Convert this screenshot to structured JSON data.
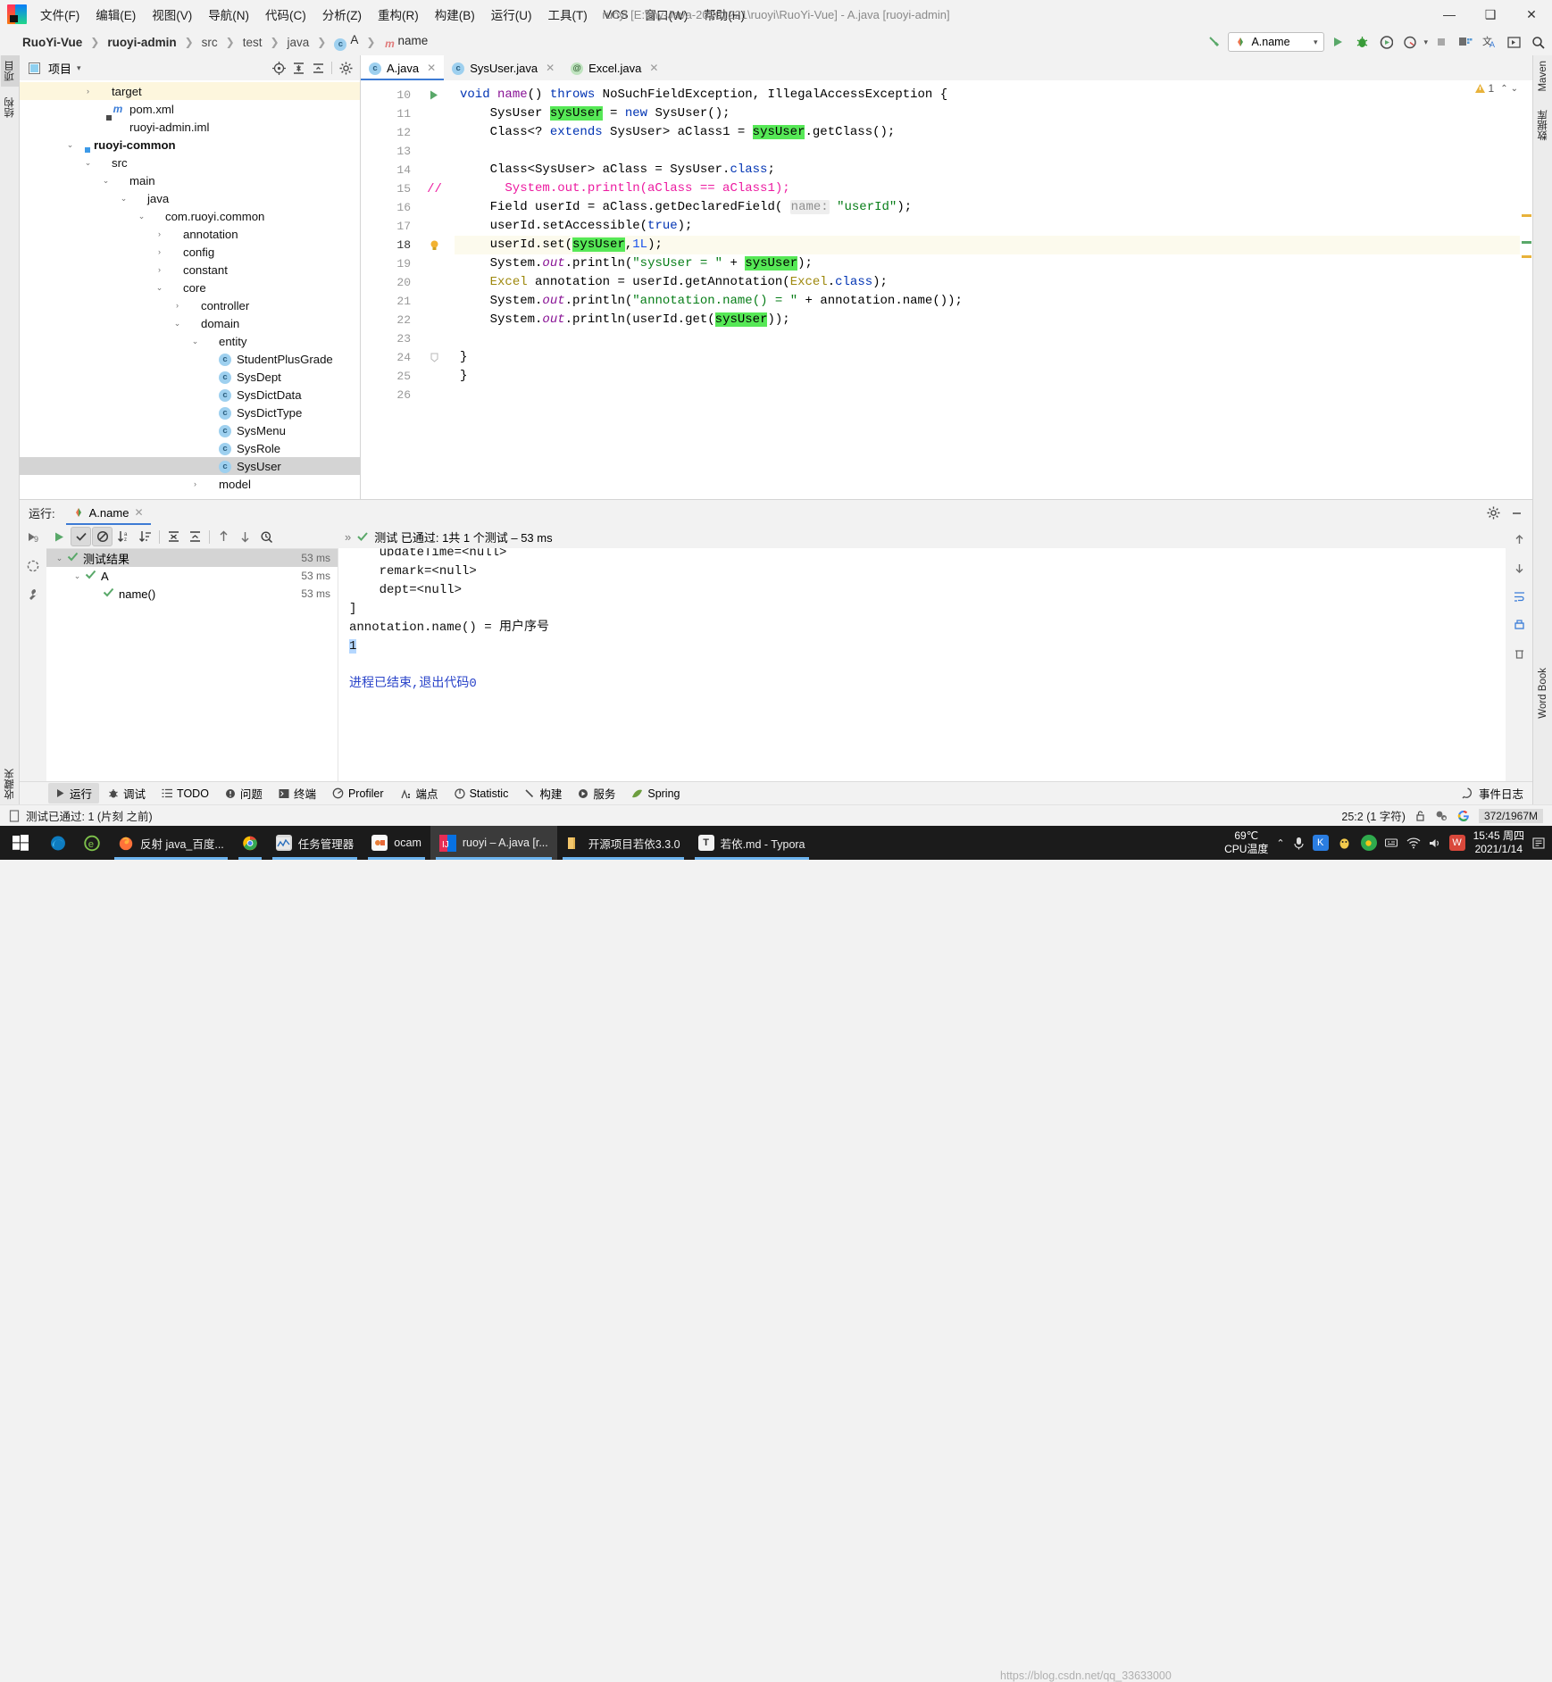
{
  "window": {
    "title": "ruoyi [E:\\my-Java-20201221\\ruoyi\\RuoYi-Vue] - A.java [ruoyi-admin]",
    "minimize": "—",
    "maximize": "❑",
    "close": "✕"
  },
  "menu": [
    {
      "label": "文件(F)"
    },
    {
      "label": "编辑(E)"
    },
    {
      "label": "视图(V)"
    },
    {
      "label": "导航(N)"
    },
    {
      "label": "代码(C)"
    },
    {
      "label": "分析(Z)"
    },
    {
      "label": "重构(R)"
    },
    {
      "label": "构建(B)"
    },
    {
      "label": "运行(U)"
    },
    {
      "label": "工具(T)"
    },
    {
      "label": "VCS"
    },
    {
      "label": "窗口(W)"
    },
    {
      "label": "帮助(H)"
    }
  ],
  "breadcrumb": [
    {
      "label": "RuoYi-Vue",
      "bold": true
    },
    {
      "label": "ruoyi-admin",
      "bold": true
    },
    {
      "label": "src"
    },
    {
      "label": "test"
    },
    {
      "label": "java"
    },
    {
      "label": "A",
      "icon": "class-icon"
    },
    {
      "label": "name",
      "icon": "method-icon"
    }
  ],
  "toolbar": {
    "run_config": "A.name",
    "run_config_dropdown": "▾",
    "buttons": [
      "build-hammer-icon",
      "run-icon",
      "debug-icon",
      "run-coverage-icon",
      "profile-icon",
      "stop-icon",
      "project-structure-icon",
      "translate-icon",
      "console-icon",
      "search-everywhere-icon"
    ]
  },
  "left_stripe": [
    {
      "label": "项目",
      "selected": true
    },
    {
      "label": "结构"
    },
    {
      "label": "收藏夹"
    }
  ],
  "right_stripe": [
    {
      "label": "Maven"
    },
    {
      "label": "数据库"
    },
    {
      "label": "Word Book"
    }
  ],
  "project_panel": {
    "title": "项目",
    "dropdown": "▾",
    "actions": [
      "locate-icon",
      "expand-all-icon",
      "collapse-all-icon",
      "settings-gear-icon"
    ],
    "tree": [
      {
        "label": "target",
        "indent": 3,
        "arrow": "›",
        "icon": "folder-orange",
        "highlight": true
      },
      {
        "label": "pom.xml",
        "indent": 4,
        "arrow": "",
        "icon": "maven-m"
      },
      {
        "label": "ruoyi-admin.iml",
        "indent": 4,
        "arrow": "",
        "icon": "iml-file"
      },
      {
        "label": "ruoyi-common",
        "indent": 2,
        "arrow": "⌄",
        "icon": "module-folder",
        "bold": true
      },
      {
        "label": "src",
        "indent": 3,
        "arrow": "⌄",
        "icon": "folder-grey"
      },
      {
        "label": "main",
        "indent": 4,
        "arrow": "⌄",
        "icon": "folder-grey"
      },
      {
        "label": "java",
        "indent": 5,
        "arrow": "⌄",
        "icon": "folder-blue"
      },
      {
        "label": "com.ruoyi.common",
        "indent": 6,
        "arrow": "⌄",
        "icon": "package"
      },
      {
        "label": "annotation",
        "indent": 7,
        "arrow": "›",
        "icon": "package"
      },
      {
        "label": "config",
        "indent": 7,
        "arrow": "›",
        "icon": "package"
      },
      {
        "label": "constant",
        "indent": 7,
        "arrow": "›",
        "icon": "package"
      },
      {
        "label": "core",
        "indent": 7,
        "arrow": "⌄",
        "icon": "package"
      },
      {
        "label": "controller",
        "indent": 8,
        "arrow": "›",
        "icon": "package"
      },
      {
        "label": "domain",
        "indent": 8,
        "arrow": "⌄",
        "icon": "package"
      },
      {
        "label": "entity",
        "indent": 9,
        "arrow": "⌄",
        "icon": "package"
      },
      {
        "label": "StudentPlusGrade",
        "indent": 10,
        "arrow": "",
        "icon": "class"
      },
      {
        "label": "SysDept",
        "indent": 10,
        "arrow": "",
        "icon": "class"
      },
      {
        "label": "SysDictData",
        "indent": 10,
        "arrow": "",
        "icon": "class"
      },
      {
        "label": "SysDictType",
        "indent": 10,
        "arrow": "",
        "icon": "class"
      },
      {
        "label": "SysMenu",
        "indent": 10,
        "arrow": "",
        "icon": "class"
      },
      {
        "label": "SysRole",
        "indent": 10,
        "arrow": "",
        "icon": "class"
      },
      {
        "label": "SysUser",
        "indent": 10,
        "arrow": "",
        "icon": "class",
        "selected": true
      },
      {
        "label": "model",
        "indent": 9,
        "arrow": "›",
        "icon": "package"
      }
    ]
  },
  "editor": {
    "tabs": [
      {
        "label": "A.java",
        "icon": "class-run-icon",
        "active": true,
        "close": "✕"
      },
      {
        "label": "SysUser.java",
        "icon": "class-icon",
        "active": false,
        "close": "✕"
      },
      {
        "label": "Excel.java",
        "icon": "annotation-icon",
        "active": false,
        "close": "✕"
      }
    ],
    "inspection": {
      "count": "1",
      "icon": "warning-triangle-icon",
      "up": "⌃",
      "down": "⌄"
    },
    "first_line_number": 10,
    "lines": [
      {
        "n": 10,
        "text": "void name() throws NoSuchFieldException, IllegalAccessException {"
      },
      {
        "n": 11,
        "text": "    SysUser sysUser = new SysUser();"
      },
      {
        "n": 12,
        "text": "    Class<? extends SysUser> aClass1 = sysUser.getClass();"
      },
      {
        "n": 13,
        "text": ""
      },
      {
        "n": 14,
        "text": "    Class<SysUser> aClass = SysUser.class;"
      },
      {
        "n": 15,
        "text": "      System.out.println(aClass == aClass1);",
        "comment_marker": "//"
      },
      {
        "n": 16,
        "text": "    Field userId = aClass.getDeclaredField( name: \"userId\");"
      },
      {
        "n": 17,
        "text": "    userId.setAccessible(true);"
      },
      {
        "n": 18,
        "text": "    userId.set(sysUser,1L);",
        "current": true,
        "bulb": true
      },
      {
        "n": 19,
        "text": "    System.out.println(\"sysUser = \" + sysUser);"
      },
      {
        "n": 20,
        "text": "    Excel annotation = userId.getAnnotation(Excel.class);"
      },
      {
        "n": 21,
        "text": "    System.out.println(\"annotation.name() = \" + annotation.name());"
      },
      {
        "n": 22,
        "text": "    System.out.println(userId.get(sysUser));"
      },
      {
        "n": 23,
        "text": ""
      },
      {
        "n": 24,
        "text": "}"
      },
      {
        "n": 25,
        "text": "}"
      },
      {
        "n": 26,
        "text": ""
      }
    ]
  },
  "run_panel": {
    "label": "运行:",
    "tab": "A.name",
    "tab_close": "✕",
    "settings_icon": "gear-icon",
    "hide_icon": "minimize-icon",
    "toolbar_icons": [
      "rerun-icon",
      "show-passed-icon",
      "show-ignored-icon",
      "sort-alpha-icon",
      "sort-duration-icon",
      "expand-all-icon",
      "collapse-all-icon",
      "prev-icon",
      "next-icon",
      "history-icon",
      "more-icon"
    ],
    "status": {
      "text": "测试 已通过: 1共 1 个测试 – 53 ms",
      "icon": "check-icon",
      "chevrons": "»"
    },
    "test_tree": [
      {
        "label": "测试结果",
        "time": "53 ms",
        "indent": 0,
        "arrow": "⌄",
        "selected": true
      },
      {
        "label": "A",
        "time": "53 ms",
        "indent": 1,
        "arrow": "⌄"
      },
      {
        "label": "name()",
        "time": "53 ms",
        "indent": 2,
        "arrow": ""
      }
    ],
    "console": [
      {
        "text": "    updateTime=<null>",
        "clipped": true
      },
      {
        "text": "    remark=<null>"
      },
      {
        "text": "    dept=<null>"
      },
      {
        "text": "]"
      },
      {
        "text": "annotation.name() = 用户序号"
      },
      {
        "text": "1",
        "selected": true
      },
      {
        "text": ""
      },
      {
        "text": "进程已结束,退出代码0",
        "link": true
      }
    ]
  },
  "bottom_tools": [
    {
      "label": "运行",
      "icon": "run-icon",
      "selected": true
    },
    {
      "label": "调试",
      "icon": "debug-icon"
    },
    {
      "label": "TODO",
      "icon": "todo-icon"
    },
    {
      "label": "问题",
      "icon": "problems-icon"
    },
    {
      "label": "终端",
      "icon": "terminal-icon"
    },
    {
      "label": "Profiler",
      "icon": "profiler-icon"
    },
    {
      "label": "端点",
      "icon": "endpoints-icon"
    },
    {
      "label": "Statistic",
      "icon": "statistic-icon"
    },
    {
      "label": "构建",
      "icon": "build-icon"
    },
    {
      "label": "服务",
      "icon": "services-icon"
    },
    {
      "label": "Spring",
      "icon": "spring-icon"
    }
  ],
  "bottom_right": {
    "label": "事件日志",
    "icon": "event-log-icon"
  },
  "statusbar": {
    "message": "测试已通过: 1 (片刻 之前)",
    "message_icon": "document-icon",
    "caret": "25:2 (1 字符)",
    "lock_icon": "lock-icon",
    "git_icon": "branch-icon",
    "google_icon": "google-icon",
    "memory": "372/1967M"
  },
  "taskbar": {
    "start_icon": "windows-start-icon",
    "items": [
      {
        "label": "",
        "icon": "edge-icon",
        "pinned": true
      },
      {
        "label": "",
        "icon": "explorer-e-icon",
        "pinned": true
      },
      {
        "label": "反射 java_百度...",
        "icon": "firefox-icon",
        "running": true
      },
      {
        "label": "",
        "icon": "chrome-icon",
        "running": true
      },
      {
        "label": "任务管理器",
        "icon": "task-manager-icon",
        "running": true
      },
      {
        "label": "ocam",
        "icon": "ocam-icon",
        "running": true
      },
      {
        "label": "ruoyi – A.java [r...",
        "icon": "intellij-icon",
        "running": true,
        "active": true
      },
      {
        "label": "开源项目若依3.3.0",
        "icon": "folder-icon",
        "running": true
      },
      {
        "label": "若依.md - Typora",
        "icon": "typora-icon",
        "running": true
      }
    ],
    "cpu_temp_value": "69℃",
    "cpu_temp_label": "CPU温度",
    "tray_expand": "⌃",
    "tray_icons": [
      "mic-icon",
      "kugou-icon",
      "qq-icon",
      "360-icon",
      "input-method-icon",
      "wifi-icon",
      "sound-icon",
      "wps-icon"
    ],
    "time": "15:45 周四",
    "date": "2021/1/14",
    "watermark": "https://blog.csdn.net/qq_33633000"
  }
}
